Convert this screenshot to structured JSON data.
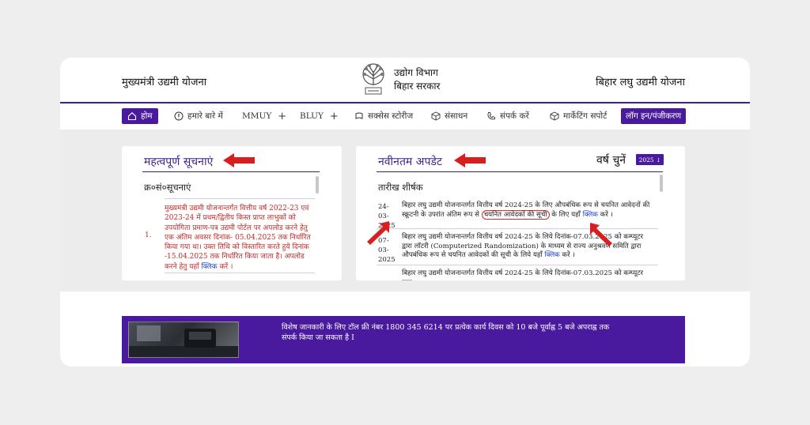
{
  "header": {
    "left_title": "मुख्यमंत्री उद्यमी योजना",
    "center_line1": "उद्योग विभाग",
    "center_line2": "बिहार सरकार",
    "right_title": "बिहार लघु उद्यमी योजना"
  },
  "nav": {
    "home": "होम",
    "about": "हमारे बारे में",
    "mmuy": "MMUY",
    "bluy": "BLUY",
    "success": "सक्सेस स्टोरीज",
    "resources": "संसाधन",
    "contact": "संपर्क करें",
    "marketing": "मार्केटिंग सपोर्ट",
    "login": "लॉग इन/पंजीकरण",
    "plus": "+"
  },
  "notices": {
    "title": "महत्वपूर्ण सूचनाएं",
    "columns": "क्र०सं०सूचनाएं",
    "item1_num": "1.",
    "item1_text": "मुख्यमंत्री उद्यमी योजनान्तर्गत वित्तीय वर्ष 2022-23 एवं 2023-24 में प्रथम/द्वितीय किस्त प्राप्त लाभुकों को उपयोगिता प्रमाण-पत्र उद्यमी पोर्टल पर अपलोड करने हेतु एक अंतिम अवसर दिनांक- 05.04.2025 तक निर्धारित किया गया था। उक्त तिथि को विस्तारित करते हुये दिनांक -15.04.2025 तक निर्धारित किया जाता है। अपलोड करने हेतु यहाँ",
    "item1_link": "क्लिक",
    "item1_end": "करें ।"
  },
  "updates": {
    "title": "नवीनतम अपडेट",
    "year_label": "वर्ष चुनें",
    "year_value": "2025 ↓",
    "columns": "तारीख शीर्षक",
    "item1_date": "24-03-2025",
    "item1_text_a": "बिहार लघु उद्यमी योजनान्तर्गत वित्तीय वर्ष 2024-25 के लिए औपबंधिक रूप से चयनित आवेदनों की स्क्रूटनी के उपरांत अंतिम रूप से",
    "item1_circled": "चयनित आवेदकों की सूची",
    "item1_text_b": "के लिए यहाँ",
    "item1_link": "क्लिक",
    "item1_end": "करें ।",
    "item2_date": "07-03-2025",
    "item2_text": "बिहार लघु उद्यमी योजनान्तर्गत वित्तीय वर्ष 2024-25 के लिये दिनांक-07.03.2025 को कम्प्यूटर द्वारा लॉटरी (Computerized Randomization) के माध्यम से राज्य अनुश्रवण समिति द्वारा औपबंधिक रूप से चयनित आवेदकों की सूची के लिये यहाँ",
    "item2_link": "क्लिक",
    "item2_end": "करें ।",
    "item3_text": "बिहार लघु उद्यमी योजनान्तर्गत वित्तीय वर्ष 2024-25 के लिये दिनांक-07.03.2025 को कम्प्यूटर द्वारा"
  },
  "info": {
    "text": "विशेष जानकारी के लिए टॉल फ्री नंबर 1800 345 6214 पर प्रत्येक कार्य दिवस को 10 बजे पूर्वाह्न 5 बजे अपराह्न तक संपर्क किया जा सकता है I"
  },
  "colors": {
    "brand_purple": "#4a1a9e",
    "heading_purple": "#3b1f8a",
    "notice_red": "#c62828",
    "link_blue": "#1a3fd1",
    "arrow_red": "#d81e1e"
  }
}
